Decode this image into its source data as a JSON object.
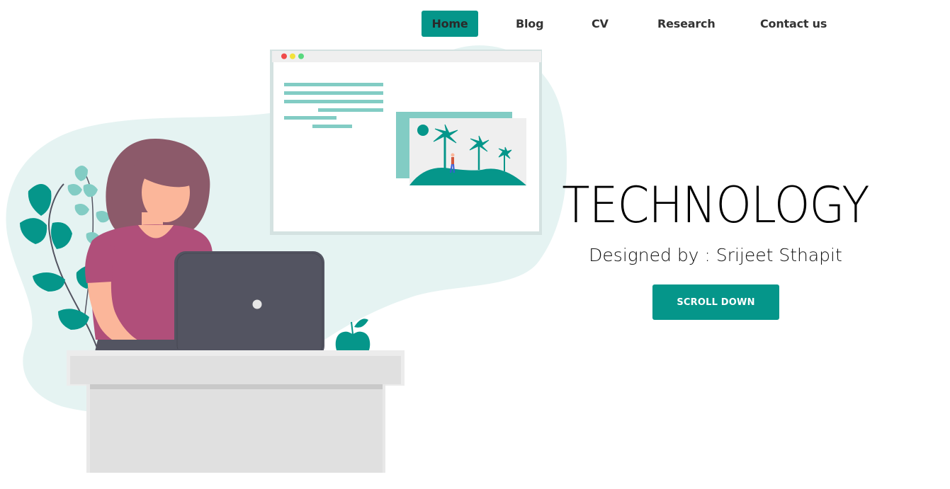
{
  "nav": {
    "items": [
      {
        "label": "Home",
        "active": true
      },
      {
        "label": "Blog",
        "active": false
      },
      {
        "label": "CV",
        "active": false
      },
      {
        "label": "Research",
        "active": false
      },
      {
        "label": "Contact us",
        "active": false
      }
    ]
  },
  "hero": {
    "title": "TECHNOLOGY",
    "subtitle": "Designed by : Srijeet Sthapit",
    "button_label": "SCROLL DOWN"
  },
  "colors": {
    "accent": "#05968a",
    "accent_light": "#82ccc4",
    "blob": "#e5f3f2",
    "shirt": "#b04f7a",
    "hair": "#8c5a6a",
    "skin": "#fbb69a",
    "laptop": "#535461",
    "desk": "#e0e0e0"
  },
  "illustration": {
    "icon": "woman-at-laptop-illustration"
  }
}
